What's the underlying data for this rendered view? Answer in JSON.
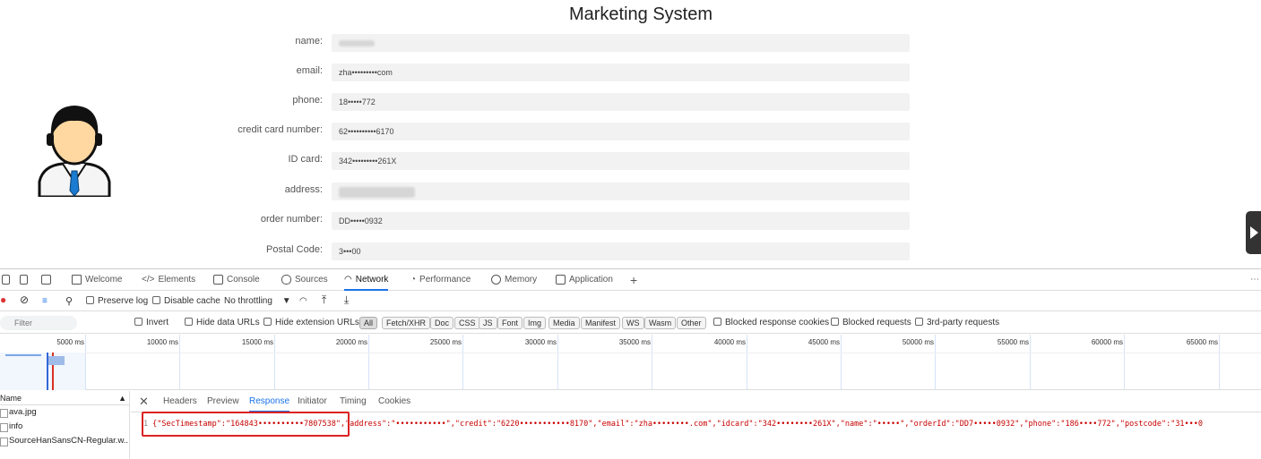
{
  "page": {
    "title": "Marketing System",
    "fields": [
      {
        "label": "name:",
        "value": ""
      },
      {
        "label": "email:",
        "value": "zha•••••••••com"
      },
      {
        "label": "phone:",
        "value": "18•••••772"
      },
      {
        "label": "credit card number:",
        "value": "62••••••••••6170"
      },
      {
        "label": "ID card:",
        "value": "342•••••••••261X"
      },
      {
        "label": "address:",
        "value": ""
      },
      {
        "label": "order number:",
        "value": "DD•••••0932"
      },
      {
        "label": "Postal Code:",
        "value": "3•••00"
      }
    ]
  },
  "devtools": {
    "tabs": [
      "Welcome",
      "Elements",
      "Console",
      "Sources",
      "Network",
      "Performance",
      "Memory",
      "Application"
    ],
    "active_tab": "Network",
    "toolbar": {
      "preserve_log": "Preserve log",
      "disable_cache": "Disable cache",
      "throttling": "No throttling"
    },
    "filter_bar": {
      "placeholder": "Filter",
      "invert": "Invert",
      "hide_data_urls": "Hide data URLs",
      "hide_extension_urls": "Hide extension URLs",
      "types": [
        "All",
        "Fetch/XHR",
        "Doc",
        "CSS",
        "JS",
        "Font",
        "Img",
        "Media",
        "Manifest",
        "WS",
        "Wasm",
        "Other"
      ],
      "blocked_cookies": "Blocked response cookies",
      "blocked_requests": "Blocked requests",
      "third_party": "3rd-party requests"
    },
    "timeline_ticks": [
      "5000 ms",
      "10000 ms",
      "15000 ms",
      "20000 ms",
      "25000 ms",
      "30000 ms",
      "35000 ms",
      "40000 ms",
      "45000 ms",
      "50000 ms",
      "55000 ms",
      "60000 ms",
      "65000 ms"
    ],
    "requests": {
      "header": "Name",
      "items": [
        "ava.jpg",
        "info",
        "SourceHanSansCN-Regular.w..."
      ]
    },
    "detail_tabs": [
      "Headers",
      "Preview",
      "Response",
      "Initiator",
      "Timing",
      "Cookies"
    ],
    "active_detail_tab": "Response",
    "response": {
      "line_number": "1",
      "highlighted": "{\"SecTimestamp\":\"164843••••••••••7807538\",",
      "rest": "\"address\":\"•••••••••••\",\"credit\":\"6220•••••••••••8170\",\"email\":\"zha••••••••.com\",\"idcard\":\"342••••••••261X\",\"name\":\"•••••\",\"orderId\":\"DD7•••••0932\",\"phone\":\"186••••772\",\"postcode\":\"31•••0"
    }
  }
}
